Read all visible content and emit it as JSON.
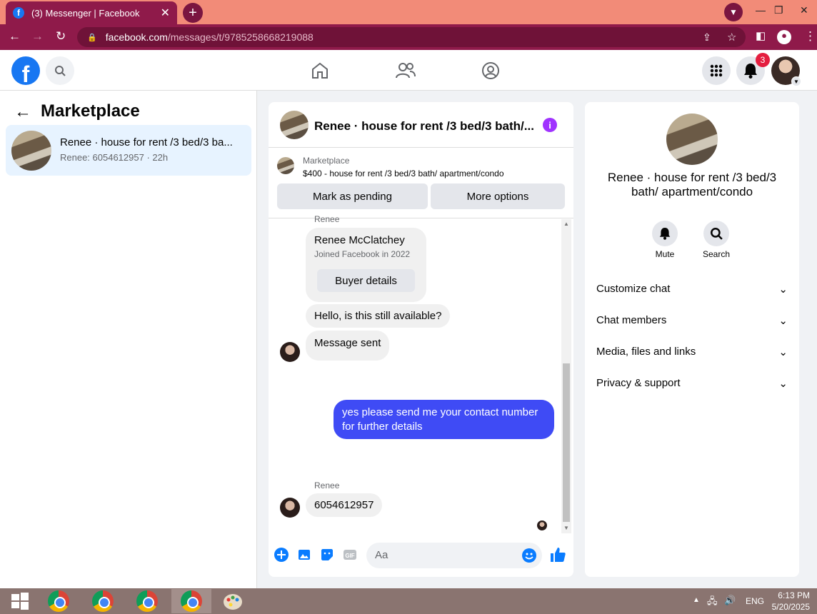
{
  "browser": {
    "tab_title": "(3) Messenger | Facebook",
    "new_tab": "+",
    "close_tab": "✕",
    "url_host": "facebook.com",
    "url_path": "/messages/t/9785258668219088"
  },
  "header": {
    "notification_count": "3"
  },
  "left_panel": {
    "title": "Marketplace",
    "conversation": {
      "name": "Renee · house for rent /3 bed/3 ba...",
      "subtitle": "Renee: 6054612957 · 22h"
    }
  },
  "chat": {
    "title": "Renee · house for rent /3 bed/3 bath/...",
    "listing_label": "Marketplace",
    "listing_desc": "$400 - house for rent /3 bed/3 bath/ apartment/condo",
    "mark_pending": "Mark as pending",
    "more_options": "More options",
    "messages": {
      "sender_top": "Renee",
      "card_name": "Renee McClatchey",
      "card_joined": "Joined Facebook in 2022",
      "buyer_details": "Buyer details",
      "msg1": "Hello, is this still available?",
      "msg2": "Message sent",
      "outgoing": "yes please send me your contact number for further details",
      "sender_bottom": "Renee",
      "msg3": "6054612957"
    },
    "composer_placeholder": "Aa"
  },
  "right_panel": {
    "title": "Renee · house for rent /3 bed/3 bath/ apartment/condo",
    "mute": "Mute",
    "search": "Search",
    "sections": [
      "Customize chat",
      "Chat members",
      "Media, files and links",
      "Privacy & support"
    ]
  },
  "taskbar": {
    "lang": "ENG",
    "time": "6:13 PM",
    "date": "5/20/2025"
  },
  "colors": {
    "tabstrip": "#f28b78",
    "toolbar": "#8f1a4a",
    "fb_blue": "#1877f2",
    "outgoing_bubble": "#3f4bf5"
  }
}
